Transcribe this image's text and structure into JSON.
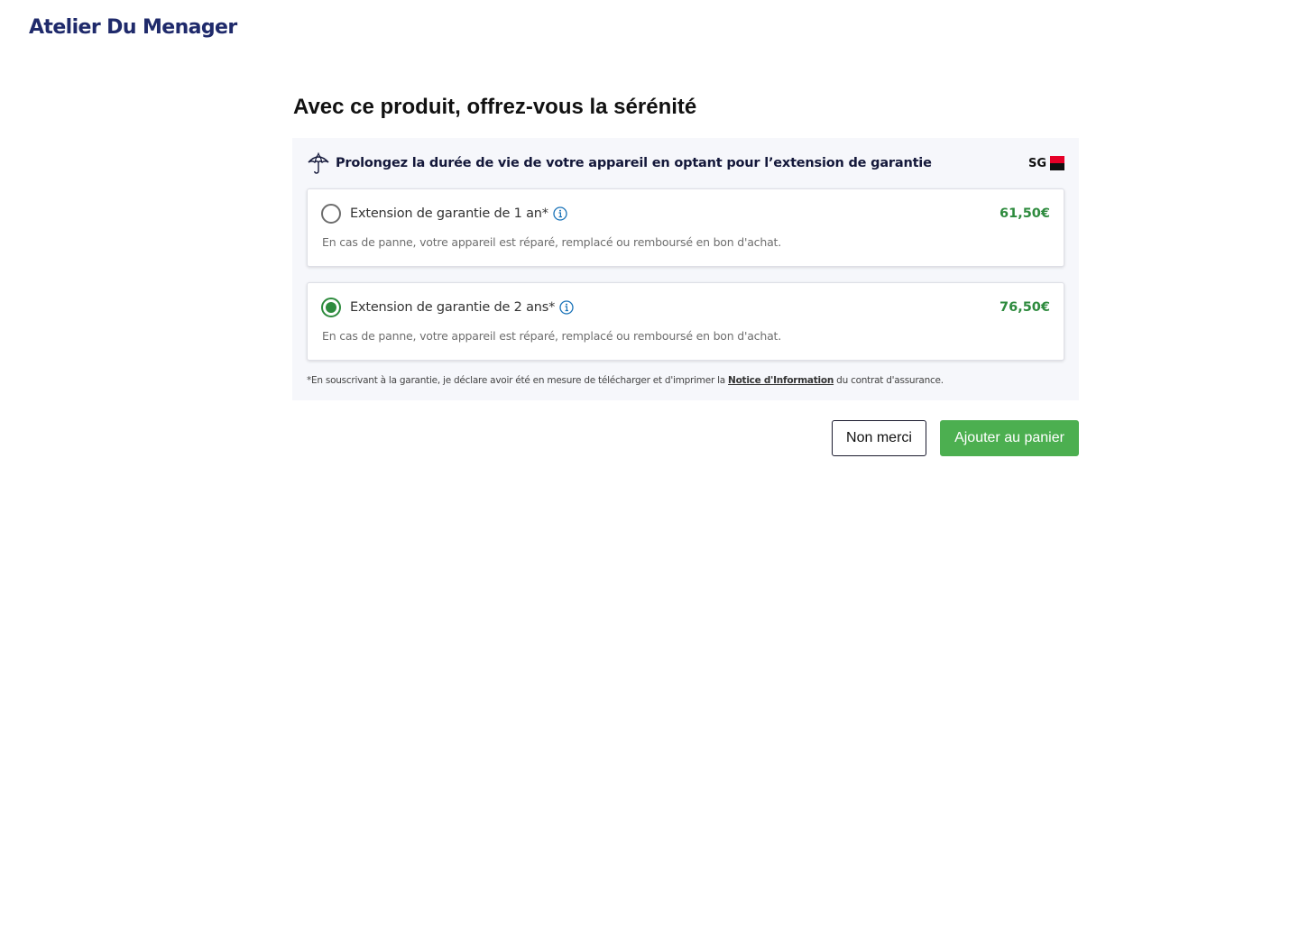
{
  "brand": {
    "logo_text": "Atelier Du Menager"
  },
  "page": {
    "title": "Avec ce produit, offrez-vous la sérénité"
  },
  "warranty_panel": {
    "header_text": "Prolongez la durée de vie de votre appareil en optant pour l’extension de garantie",
    "header_icon": "umbrella-icon",
    "insurer_name": "SG",
    "insurer_logo_colors": [
      "#e60028",
      "#111111"
    ],
    "options": [
      {
        "label": "Extension de garantie de 1 an*",
        "price": "61,50€",
        "description": "En cas de panne, votre appareil est réparé, remplacé ou remboursé en bon d'achat.",
        "selected": false
      },
      {
        "label": "Extension de garantie de 2 ans*",
        "price": "76,50€",
        "description": "En cas de panne, votre appareil est réparé, remplacé ou remboursé en bon d'achat.",
        "selected": true
      }
    ],
    "disclaimer": {
      "prefix": "*En souscrivant à la garantie, je déclare avoir été en mesure de télécharger et d'imprimer la ",
      "link_text": "Notice d'Information",
      "suffix": " du contrat d'assurance."
    }
  },
  "actions": {
    "decline_label": "Non merci",
    "add_to_cart_label": "Ajouter au panier"
  },
  "colors": {
    "accent_green": "#4caf50",
    "price_green": "#2e8b3e",
    "brand_navy": "#1f2a6b",
    "info_blue": "#1a73b8"
  }
}
